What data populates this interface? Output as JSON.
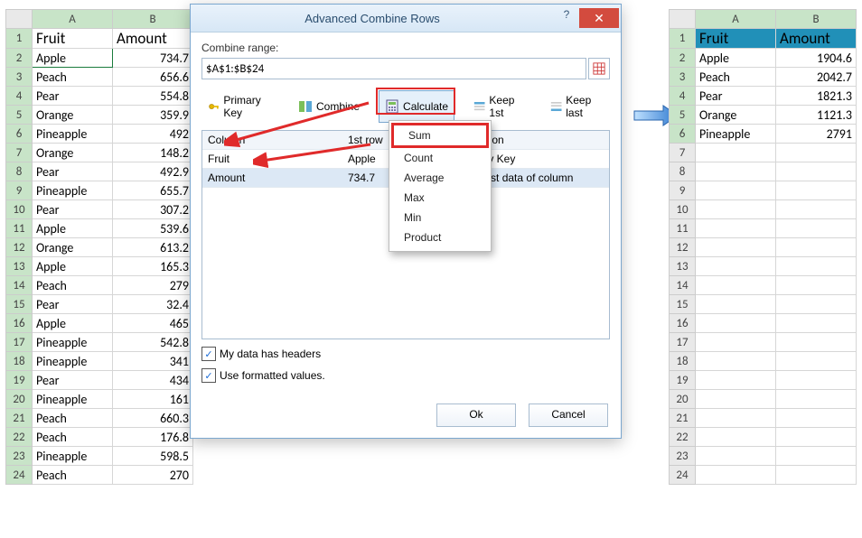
{
  "leftSheet": {
    "headers": {
      "A": "A",
      "B": "B"
    },
    "th": {
      "fruit": "Fruit",
      "amount": "Amount"
    },
    "rows": [
      {
        "n": "2",
        "fruit": "Apple",
        "amt": "734.7"
      },
      {
        "n": "3",
        "fruit": "Peach",
        "amt": "656.6"
      },
      {
        "n": "4",
        "fruit": "Pear",
        "amt": "554.8"
      },
      {
        "n": "5",
        "fruit": "Orange",
        "amt": "359.9"
      },
      {
        "n": "6",
        "fruit": "Pineapple",
        "amt": "492"
      },
      {
        "n": "7",
        "fruit": "Orange",
        "amt": "148.2"
      },
      {
        "n": "8",
        "fruit": "Pear",
        "amt": "492.9"
      },
      {
        "n": "9",
        "fruit": "Pineapple",
        "amt": "655.7"
      },
      {
        "n": "10",
        "fruit": "Pear",
        "amt": "307.2"
      },
      {
        "n": "11",
        "fruit": "Apple",
        "amt": "539.6"
      },
      {
        "n": "12",
        "fruit": "Orange",
        "amt": "613.2"
      },
      {
        "n": "13",
        "fruit": "Apple",
        "amt": "165.3"
      },
      {
        "n": "14",
        "fruit": "Peach",
        "amt": "279"
      },
      {
        "n": "15",
        "fruit": "Pear",
        "amt": "32.4"
      },
      {
        "n": "16",
        "fruit": "Apple",
        "amt": "465"
      },
      {
        "n": "17",
        "fruit": "Pineapple",
        "amt": "542.8"
      },
      {
        "n": "18",
        "fruit": "Pineapple",
        "amt": "341"
      },
      {
        "n": "19",
        "fruit": "Pear",
        "amt": "434"
      },
      {
        "n": "20",
        "fruit": "Pineapple",
        "amt": "161"
      },
      {
        "n": "21",
        "fruit": "Peach",
        "amt": "660.3"
      },
      {
        "n": "22",
        "fruit": "Peach",
        "amt": "176.8"
      },
      {
        "n": "23",
        "fruit": "Pineapple",
        "amt": "598.5"
      },
      {
        "n": "24",
        "fruit": "Peach",
        "amt": "270"
      }
    ]
  },
  "rightSheet": {
    "headers": {
      "A": "A",
      "B": "B"
    },
    "th": {
      "fruit": "Fruit",
      "amount": "Amount"
    },
    "emptyRows": [
      "7",
      "8",
      "9",
      "10",
      "11",
      "12",
      "13",
      "14",
      "15",
      "16",
      "17",
      "18",
      "19",
      "20",
      "21",
      "22",
      "23",
      "24"
    ],
    "rows": [
      {
        "n": "2",
        "fruit": "Apple",
        "amt": "1904.6"
      },
      {
        "n": "3",
        "fruit": "Peach",
        "amt": "2042.7"
      },
      {
        "n": "4",
        "fruit": "Pear",
        "amt": "1821.3"
      },
      {
        "n": "5",
        "fruit": "Orange",
        "amt": "1121.3"
      },
      {
        "n": "6",
        "fruit": "Pineapple",
        "amt": "2791"
      }
    ]
  },
  "dialog": {
    "title": "Advanced Combine Rows",
    "combineRangeLabel": "Combine range:",
    "rangeValue": "$A$1:$B$24",
    "toolbar": {
      "primaryKey": "Primary Key",
      "combine": "Combine",
      "calculate": "Calculate",
      "keep1st": "Keep 1st",
      "keepLast": "Keep last"
    },
    "gridHeaders": {
      "col": "Column",
      "row1": "1st row",
      "op": "Operation"
    },
    "gridRows": [
      {
        "col": "Fruit",
        "row1": "Apple",
        "op": "Primary Key"
      },
      {
        "col": "Amount",
        "row1": "734.7",
        "op": "Keep 1st data of column"
      }
    ],
    "dropdown": {
      "sum": "Sum",
      "count": "Count",
      "average": "Average",
      "max": "Max",
      "min": "Min",
      "product": "Product"
    },
    "chkHeaders": "My data has headers",
    "chkFormatted": "Use formatted values.",
    "ok": "Ok",
    "cancel": "Cancel",
    "help": "?",
    "close": "✕"
  }
}
